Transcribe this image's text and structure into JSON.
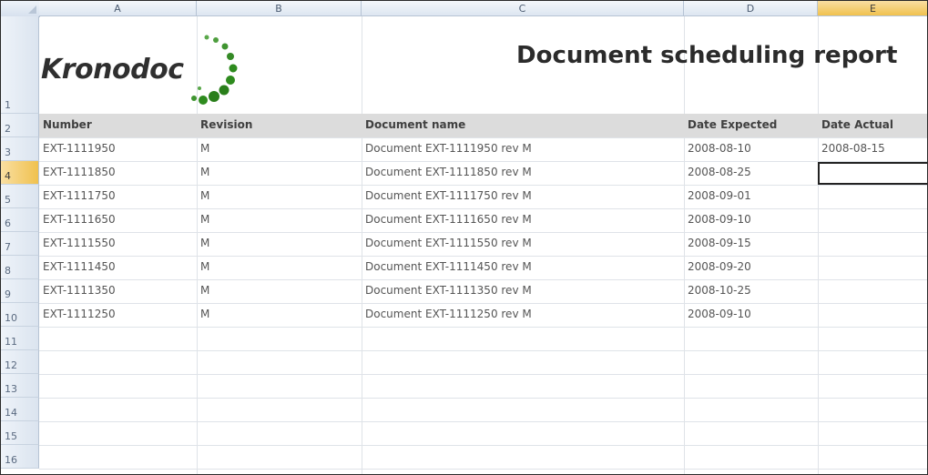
{
  "sheet": {
    "column_headers": [
      "A",
      "B",
      "C",
      "D",
      "E"
    ],
    "active_column": "E",
    "active_row": "4",
    "row_numbers": [
      "1",
      "2",
      "3",
      "4",
      "5",
      "6",
      "7",
      "8",
      "9",
      "10",
      "11",
      "12",
      "13",
      "14",
      "15",
      "16"
    ]
  },
  "logo": {
    "text": "Kronodoc",
    "accent_color": "#2e8b1e"
  },
  "report_title": "Document scheduling report",
  "table": {
    "headers": [
      "Number",
      "Revision",
      "Document name",
      "Date Expected",
      "Date Actual"
    ],
    "rows": [
      [
        "EXT-1111950",
        "M",
        "Document EXT-1111950 rev M",
        "2008-08-10",
        "2008-08-15"
      ],
      [
        "EXT-1111850",
        "M",
        "Document EXT-1111850 rev M",
        "2008-08-25",
        ""
      ],
      [
        "EXT-1111750",
        "M",
        "Document EXT-1111750 rev M",
        "2008-09-01",
        ""
      ],
      [
        "EXT-1111650",
        "M",
        "Document EXT-1111650 rev M",
        "2008-09-10",
        ""
      ],
      [
        "EXT-1111550",
        "M",
        "Document EXT-1111550 rev M",
        "2008-09-15",
        ""
      ],
      [
        "EXT-1111450",
        "M",
        "Document EXT-1111450 rev M",
        "2008-09-20",
        ""
      ],
      [
        "EXT-1111350",
        "M",
        "Document EXT-1111350 rev M",
        "2008-10-25",
        ""
      ],
      [
        "EXT-1111250",
        "M",
        "Document EXT-1111250 rev M",
        "2008-09-10",
        ""
      ]
    ]
  },
  "colors": {
    "header_band": "#dcdcdc",
    "active_header": "#f0c14e",
    "gridline": "#dfe3e8"
  }
}
